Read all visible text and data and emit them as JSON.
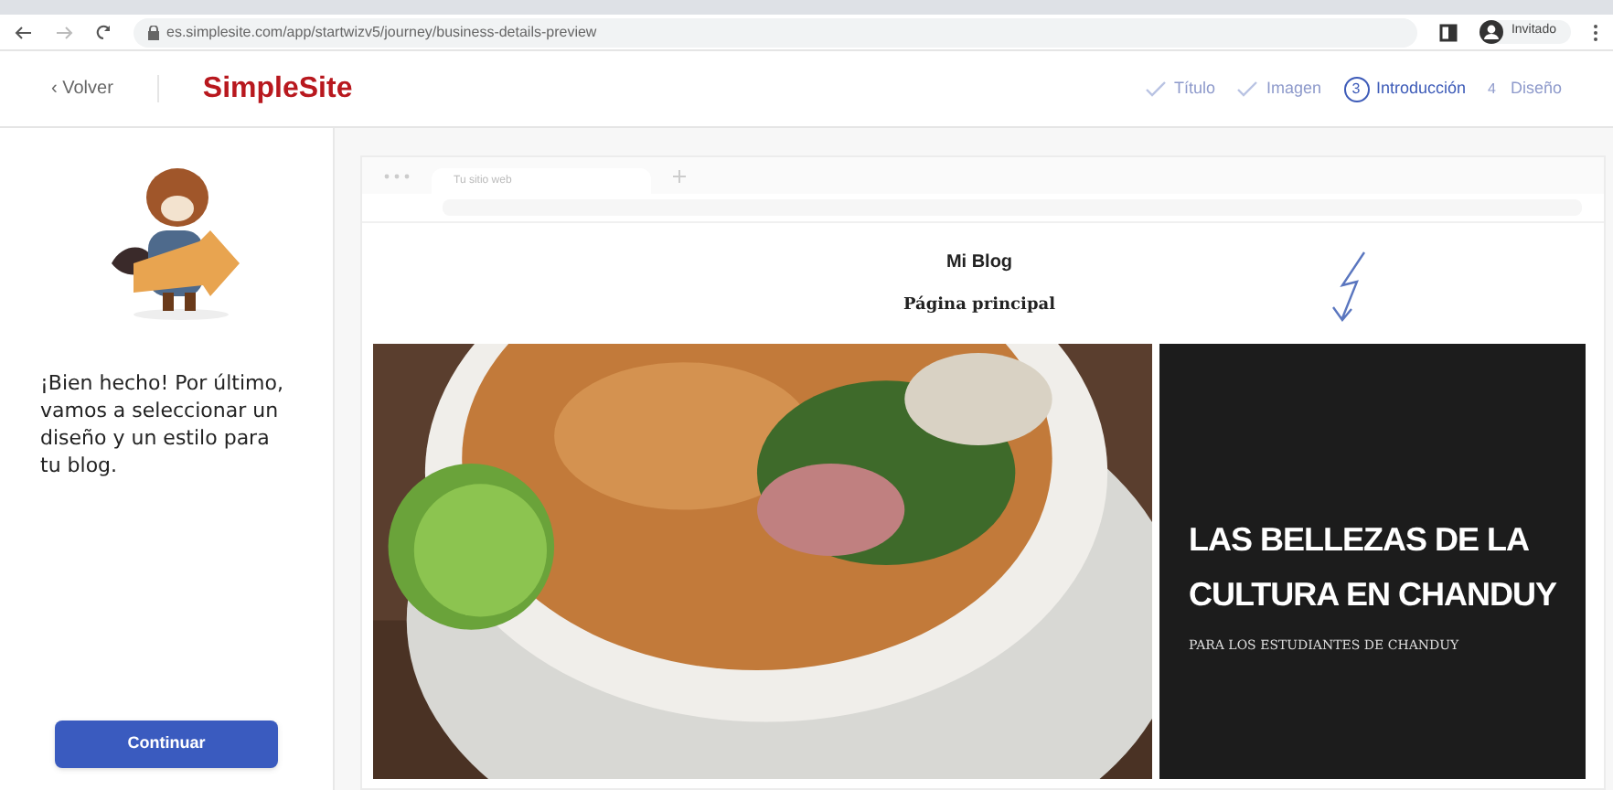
{
  "browser": {
    "url": "es.simplesite.com/app/startwizv5/journey/business-details-preview",
    "profile": "Invitado"
  },
  "header": {
    "back": "‹ Volver",
    "logo": "SimpleSite",
    "steps": [
      {
        "label": "Título",
        "kind": "done"
      },
      {
        "label": "Imagen",
        "kind": "done"
      },
      {
        "label": "Introducción",
        "kind": "current",
        "number": "3"
      },
      {
        "label": "Diseño",
        "kind": "upcoming",
        "number": "4"
      }
    ]
  },
  "sidebar": {
    "message": "¡Bien hecho! Por último, vamos a seleccionar un diseño y un estilo para tu blog.",
    "button": "Continuar"
  },
  "preview": {
    "tab": "Tu sitio web",
    "site_title": "Mi Blog",
    "nav": "Página principal",
    "hero_title": "LAS BELLEZAS DE LA CULTURA EN CHANDUY",
    "hero_subtitle": "PARA LOS ESTUDIANTES DE CHANDUY"
  }
}
